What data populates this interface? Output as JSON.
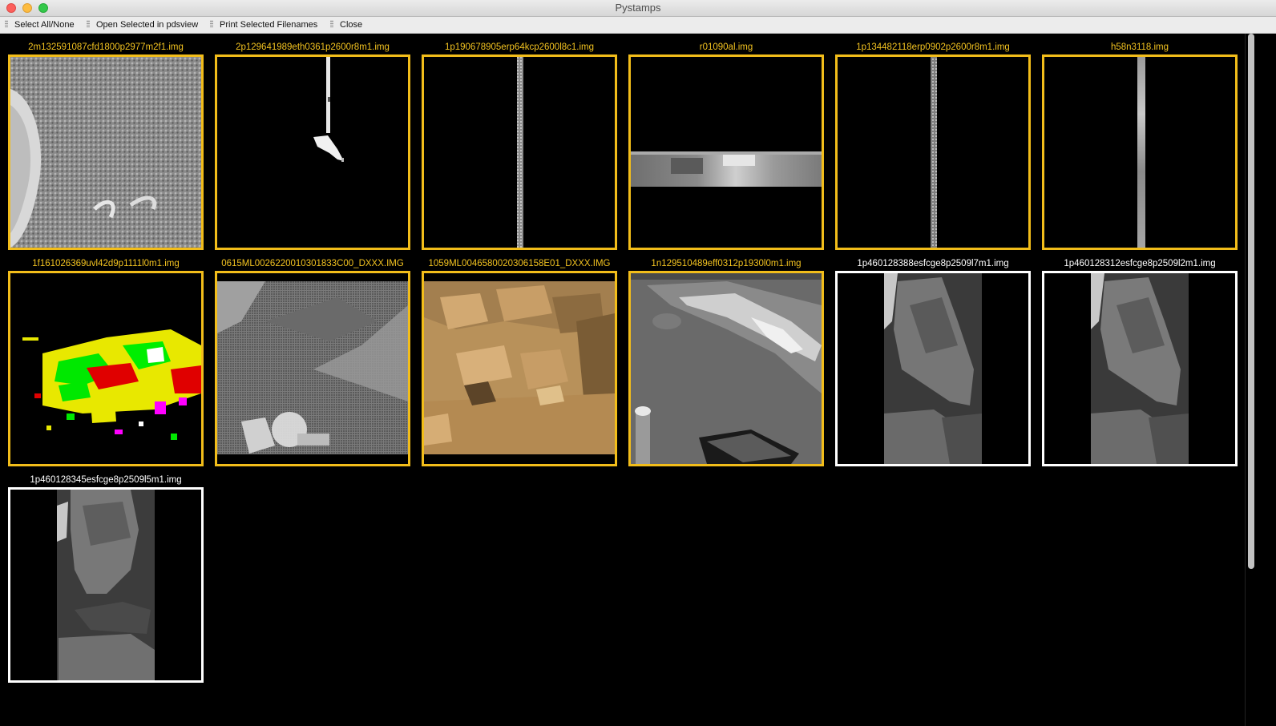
{
  "window": {
    "title": "Pystamps"
  },
  "toolbar": {
    "select_all": "Select All/None",
    "open_selected": "Open Selected in pdsview",
    "print_selected": "Print Selected Filenames",
    "close": "Close"
  },
  "colors": {
    "selected": "#f2bd1a",
    "unselected": "#ffffff",
    "background": "#000000"
  },
  "stamps": [
    {
      "filename": "2m132591087cfd1800p2977m2f1.img",
      "selected": true
    },
    {
      "filename": "2p129641989eth0361p2600r8m1.img",
      "selected": true
    },
    {
      "filename": "1p190678905erp64kcp2600l8c1.img",
      "selected": true
    },
    {
      "filename": "r01090al.img",
      "selected": true
    },
    {
      "filename": "1p134482118erp0902p2600r8m1.img",
      "selected": true
    },
    {
      "filename": "h58n3118.img",
      "selected": true
    },
    {
      "filename": "1f161026369uvl42d9p1111l0m1.img",
      "selected": true
    },
    {
      "filename": "0615ML0026220010301833C00_DXXX.IMG",
      "selected": true
    },
    {
      "filename": "1059ML0046580020306158E01_DXXX.IMG",
      "selected": true
    },
    {
      "filename": "1n129510489eff0312p1930l0m1.img",
      "selected": true
    },
    {
      "filename": "1p460128388esfcge8p2509l7m1.img",
      "selected": false
    },
    {
      "filename": "1p460128312esfcge8p2509l2m1.img",
      "selected": false
    },
    {
      "filename": "1p460128345esfcge8p2509l5m1.img",
      "selected": false
    }
  ]
}
